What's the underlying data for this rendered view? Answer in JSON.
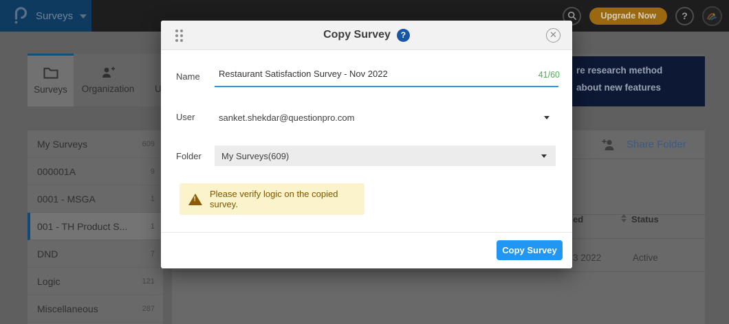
{
  "topbar": {
    "product": "Surveys",
    "upgrade": "Upgrade Now",
    "help": "?"
  },
  "tabs": {
    "surveys": "Surveys",
    "organization": "Organization",
    "users": "Us"
  },
  "sidebar": {
    "items": [
      {
        "label": "My Surveys",
        "count": "609"
      },
      {
        "label": "000001A",
        "count": "9"
      },
      {
        "label": "0001 - MSGA",
        "count": "1"
      },
      {
        "label": "001 - TH Product S...",
        "count": "1"
      },
      {
        "label": "DND",
        "count": "7"
      },
      {
        "label": "Logic",
        "count": "121"
      },
      {
        "label": "Miscellaneous",
        "count": "287"
      }
    ]
  },
  "banner": {
    "line1": "re research method",
    "line2": "about new features"
  },
  "folder_panel": {
    "share": "Share Folder",
    "table": {
      "header_col1": "ed",
      "header_col2": "Status",
      "row_col1": "3 2022",
      "row_col2": "Active"
    }
  },
  "modal": {
    "title": "Copy Survey",
    "help_icon": "?",
    "name_label": "Name",
    "name_value": "Restaurant Satisfaction Survey - Nov 2022",
    "name_counter": "41/60",
    "user_label": "User",
    "user_value": "sanket.shekdar@questionpro.com",
    "folder_label": "Folder",
    "folder_value": "My Surveys(609)",
    "warning": "Please verify logic on the copied survey.",
    "submit": "Copy Survey"
  },
  "colors": {
    "accent_blue": "#2196f3",
    "counter_green": "#4caf50",
    "warning_bg": "#faf3cb",
    "warning_text": "#7d5600",
    "topbar_blue": "#0f3a5f",
    "banner_navy": "#0d1834",
    "upgrade_gold": "#9a680e"
  }
}
